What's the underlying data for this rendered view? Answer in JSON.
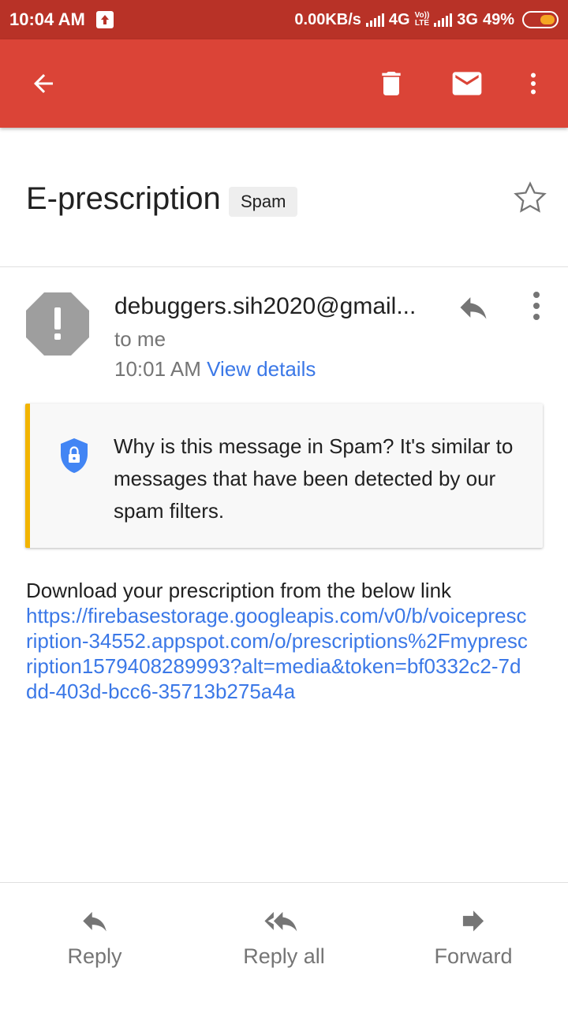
{
  "status_bar": {
    "time": "10:04 AM",
    "speed": "0.00KB/s",
    "network1": "4G",
    "network1_sub": "LTE",
    "volte": "Vo))",
    "network2": "3G",
    "battery": "49%"
  },
  "app_bar": {
    "icons": [
      "back-arrow-icon",
      "trash-icon",
      "mail-icon",
      "more-vert-icon"
    ],
    "color": "#db4437"
  },
  "email": {
    "subject": "E-prescription",
    "label": "Spam",
    "sender": "debuggers.sih2020@gmail...",
    "recipient": "to me",
    "time": "10:01 AM",
    "view_details": "View details",
    "spam_warning": "Why is this message in Spam? It's similar to messages that have been detected by our spam filters.",
    "body_intro": "Download your prescription from the below link",
    "body_link": "https://firebasestorage.googleapis.com/v0/b/voiceprescription-34552.appspot.com/o/prescriptions%2Fmyprescription1579408289993?alt=media&token=bf0332c2-7ddd-403d-bcc6-35713b275a4a"
  },
  "actions": {
    "reply": "Reply",
    "reply_all": "Reply all",
    "forward": "Forward"
  }
}
